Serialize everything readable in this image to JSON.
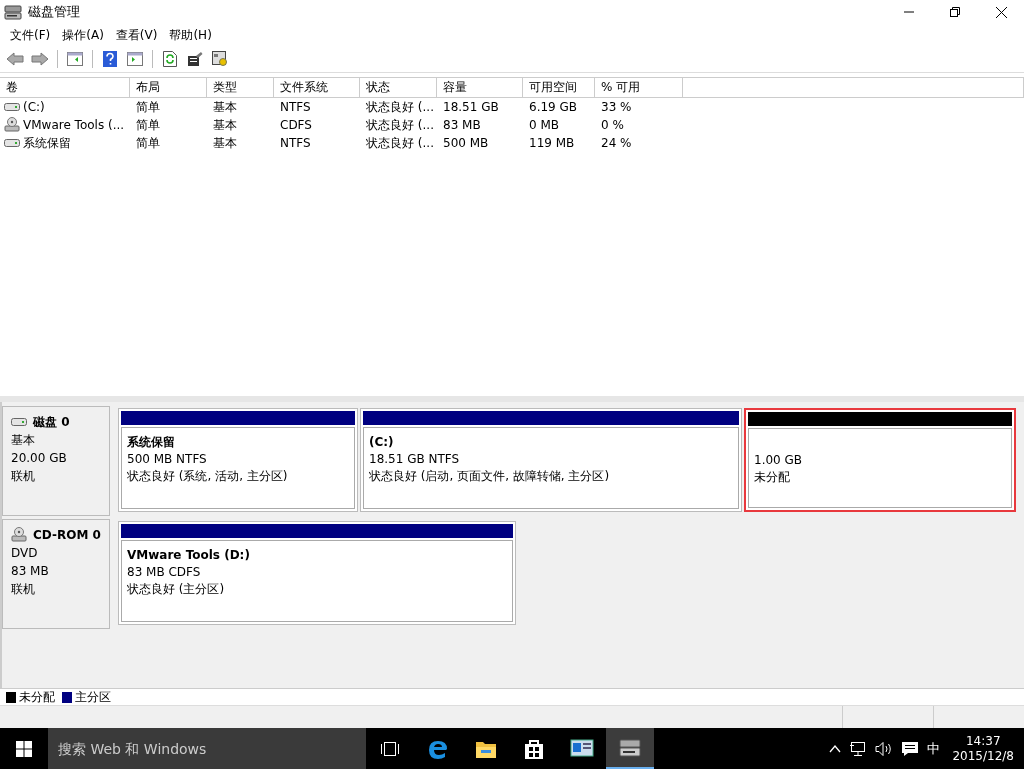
{
  "window": {
    "title": "磁盘管理"
  },
  "menu": [
    "文件(F)",
    "操作(A)",
    "查看(V)",
    "帮助(H)"
  ],
  "volume_table": {
    "columns": [
      "卷",
      "布局",
      "类型",
      "文件系统",
      "状态",
      "容量",
      "可用空间",
      "% 可用"
    ],
    "rows": [
      {
        "kind": "drive",
        "cells": [
          "(C:)",
          "简单",
          "基本",
          "NTFS",
          "状态良好 (...",
          "18.51 GB",
          "6.19 GB",
          "33 %"
        ]
      },
      {
        "kind": "cd",
        "cells": [
          "VMware Tools (...",
          "简单",
          "基本",
          "CDFS",
          "状态良好 (...",
          "83 MB",
          "0 MB",
          "0 %"
        ]
      },
      {
        "kind": "drive",
        "cells": [
          "系统保留",
          "简单",
          "基本",
          "NTFS",
          "状态良好 (...",
          "500 MB",
          "119 MB",
          "24 %"
        ]
      }
    ]
  },
  "disks": [
    {
      "kind": "drive",
      "name": "磁盘 0",
      "type": "基本",
      "size": "20.00 GB",
      "state": "联机",
      "partitions": [
        {
          "name": "系统保留",
          "info": "500 MB NTFS",
          "status": "状态良好 (系统, 活动, 主分区)",
          "color": "#000080",
          "selected": false
        },
        {
          "name": "(C:)",
          "info": "18.51 GB NTFS",
          "status": "状态良好 (启动, 页面文件, 故障转储, 主分区)",
          "color": "#000080",
          "selected": false
        },
        {
          "info": "1.00 GB",
          "status": "未分配",
          "color": "#000000",
          "selected": true
        }
      ]
    },
    {
      "kind": "cd",
      "name": "CD-ROM 0",
      "type": "DVD",
      "size": "83 MB",
      "state": "联机",
      "partitions": [
        {
          "name": "VMware Tools  (D:)",
          "info": "83 MB CDFS",
          "status": "状态良好 (主分区)",
          "color": "#000080",
          "selected": false
        }
      ]
    }
  ],
  "legend": [
    {
      "label": "未分配",
      "color": "#000000"
    },
    {
      "label": "主分区",
      "color": "#000080"
    }
  ],
  "taskbar": {
    "search": {
      "placeholder": "搜索 Web 和 Windows"
    },
    "apps": [
      {
        "kind": "taskview",
        "selected": false
      },
      {
        "kind": "edge",
        "selected": false
      },
      {
        "kind": "explorer",
        "selected": false
      },
      {
        "kind": "store",
        "selected": false
      },
      {
        "kind": "control",
        "selected": false
      },
      {
        "kind": "diskmgmt",
        "selected": true
      }
    ],
    "ime": "中",
    "time": "14:37",
    "date": "2015/12/8"
  }
}
